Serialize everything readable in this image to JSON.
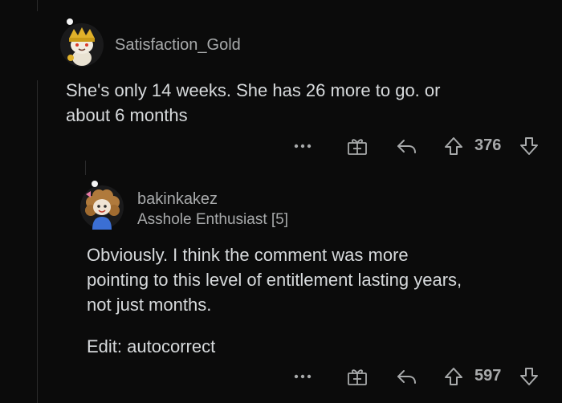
{
  "comments": [
    {
      "username": "Satisfaction_Gold",
      "body": [
        "She's only 14 weeks. She has 26 more to go. or",
        "about 6 months"
      ],
      "score": "376",
      "avatar": "snoo-avatar-gold-hat",
      "actions": [
        "more-options-icon",
        "gift-icon",
        "reply-icon",
        "upvote-icon",
        "downvote-icon"
      ]
    },
    {
      "username": "bakinkakez",
      "flair": "Asshole Enthusiast [5]",
      "body": [
        "Obviously. I think the comment was more",
        "pointing to this level of entitlement lasting years,",
        "not just months."
      ],
      "edit": "Edit: autocorrect",
      "score": "597",
      "avatar": "snoo-avatar-curly-hair",
      "actions": [
        "more-options-icon",
        "gift-icon",
        "reply-icon",
        "upvote-icon",
        "downvote-icon"
      ]
    }
  ],
  "colors": {
    "background": "#0b0b0b",
    "text": "#d7dadc",
    "muted": "#a8aaab"
  }
}
